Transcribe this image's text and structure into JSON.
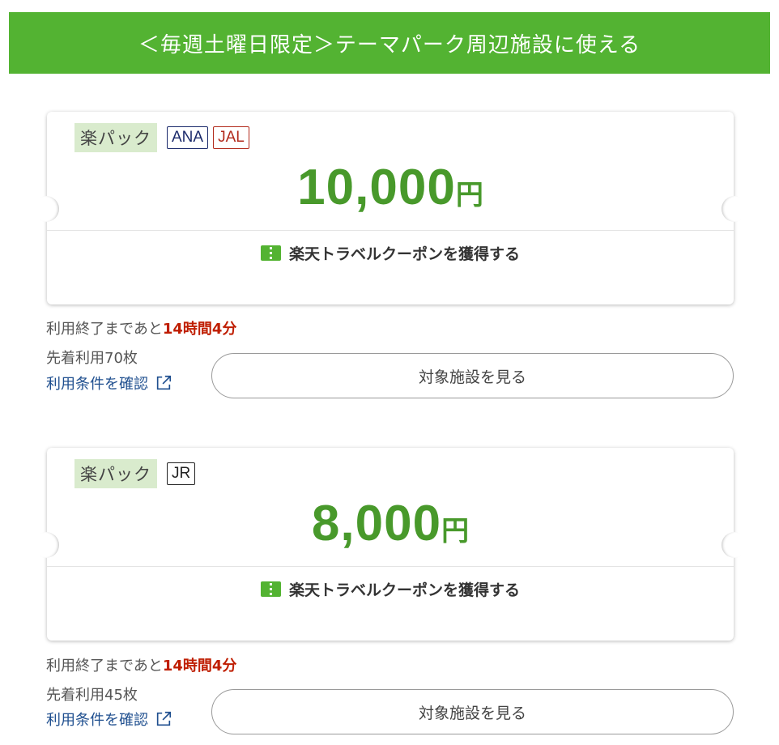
{
  "header": {
    "title": "＜毎週土曜日限定＞テーマパーク周辺施設に使える"
  },
  "colors": {
    "accent_green": "#53b332",
    "amount_green": "#48992b",
    "alert_red": "#bf1d00",
    "link_blue": "#1f4f8f"
  },
  "coupons": [
    {
      "pack_label": "楽パック",
      "badges": [
        {
          "label": "ANA",
          "color": "#1b2a6b"
        },
        {
          "label": "JAL",
          "color": "#b22a1c"
        }
      ],
      "amount": "10,000",
      "currency": "円",
      "acquire_label": "楽天トラベルクーポンを獲得する",
      "remaining_prefix": "利用終了まであと",
      "remaining_time": "14時間4分",
      "stock": "先着利用70枚",
      "terms_link": "利用条件を確認",
      "view_button": "対象施設を見る"
    },
    {
      "pack_label": "楽パック",
      "badges": [
        {
          "label": "JR",
          "color": "#222222"
        }
      ],
      "amount": "8,000",
      "currency": "円",
      "acquire_label": "楽天トラベルクーポンを獲得する",
      "remaining_prefix": "利用終了まであと",
      "remaining_time": "14時間4分",
      "stock": "先着利用45枚",
      "terms_link": "利用条件を確認",
      "view_button": "対象施設を見る"
    }
  ]
}
